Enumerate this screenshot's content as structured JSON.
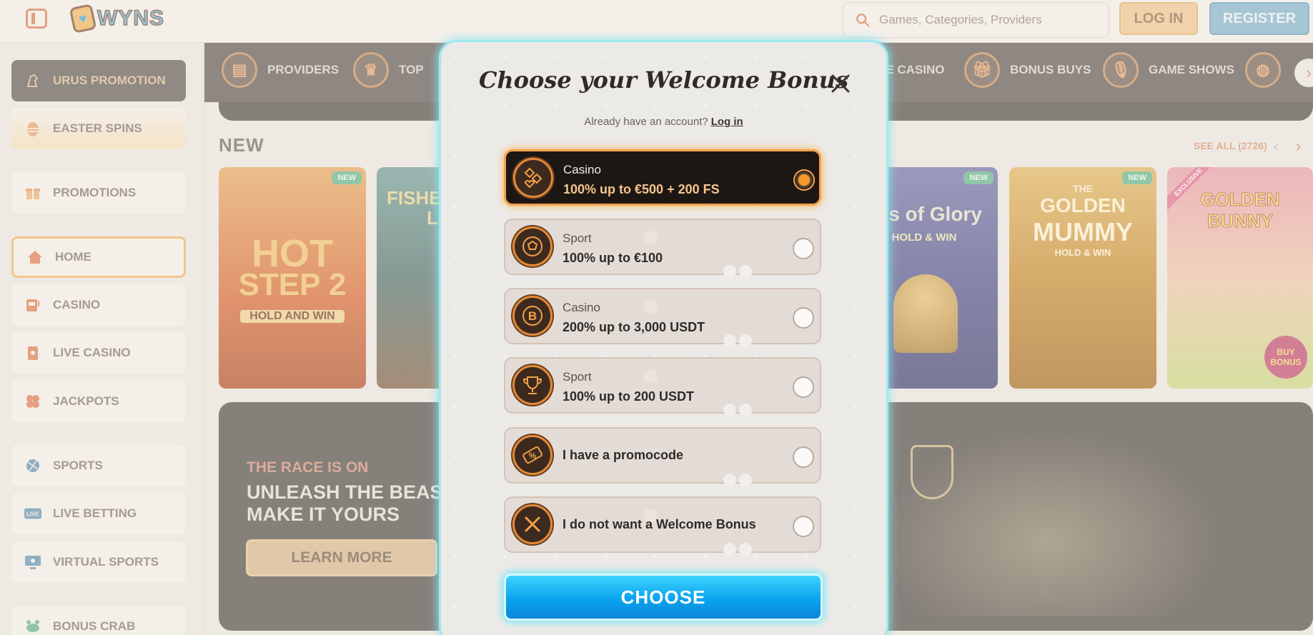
{
  "header": {
    "logo_text": "WYNS",
    "search_placeholder": "Games, Categories, Providers",
    "login_label": "LOG IN",
    "register_label": "REGISTER"
  },
  "sidebar": {
    "items": [
      {
        "label": "URUS PROMOTION",
        "icon": "bull-icon"
      },
      {
        "label": "EASTER SPINS",
        "icon": "egg-icon"
      },
      {
        "label": "PROMOTIONS",
        "icon": "gift-icon"
      },
      {
        "label": "HOME",
        "icon": "home-icon"
      },
      {
        "label": "CASINO",
        "icon": "slot-machine-icon"
      },
      {
        "label": "LIVE CASINO",
        "icon": "cards-icon"
      },
      {
        "label": "JACKPOTS",
        "icon": "clover-icon"
      },
      {
        "label": "SPORTS",
        "icon": "ball-icon"
      },
      {
        "label": "LIVE BETTING",
        "icon": "live-icon"
      },
      {
        "label": "VIRTUAL SPORTS",
        "icon": "monitor-icon"
      },
      {
        "label": "BONUS CRAB",
        "icon": "crab-icon"
      }
    ]
  },
  "categories": [
    {
      "label": "PROVIDERS"
    },
    {
      "label": "TOP"
    },
    {
      "label": "VE CASINO"
    },
    {
      "label": "BONUS BUYS"
    },
    {
      "label": "GAME SHOWS"
    }
  ],
  "new_section": {
    "title": "NEW",
    "see_all": "SEE ALL (2726)",
    "badge": "NEW",
    "exclusive": "EXCLUSIVE",
    "games": [
      {
        "title_a": "HOT",
        "title_b": "STEP 2",
        "title_c": "HOLD AND WIN"
      },
      {
        "title_a": "FISHE",
        "title_b": "LI"
      },
      {
        "title_a": "ells of Glory",
        "title_b": "HOLD & WIN"
      },
      {
        "title_a": "THE",
        "title_b": "GOLDEN",
        "title_c": "MUMMY",
        "title_d": "HOLD & WIN"
      },
      {
        "title_a": "GOLDEN",
        "title_b": "BUNNY",
        "title_c": "BUY BONUS"
      }
    ]
  },
  "promo": {
    "kicker": "THE RACE IS ON",
    "title_line1": "UNLEASH THE BEAST",
    "title_line2": "MAKE IT YOURS",
    "cta": "LEARN MORE"
  },
  "modal": {
    "title": "Choose your Welcome Bonus",
    "subtitle": "Already have an account?",
    "login_link": "Log in",
    "options": [
      {
        "type": "Casino",
        "offer": "100% up to €500 + 200 FS",
        "selected": true
      },
      {
        "type": "Sport",
        "offer": "100% up to €100",
        "selected": false
      },
      {
        "type": "Casino",
        "offer": "200% up to 3,000 USDT",
        "selected": false
      },
      {
        "type": "Sport",
        "offer": "100% up to 200 USDT",
        "selected": false
      },
      {
        "type": "",
        "offer": "I have a promocode",
        "selected": false
      },
      {
        "type": "",
        "offer": "I do not want a Welcome Bonus",
        "selected": false
      }
    ],
    "choose_label": "CHOOSE"
  },
  "colors": {
    "accent_orange": "#f3a34a",
    "accent_blue": "#0aa3ee",
    "modal_glow": "#8fe3ee"
  }
}
